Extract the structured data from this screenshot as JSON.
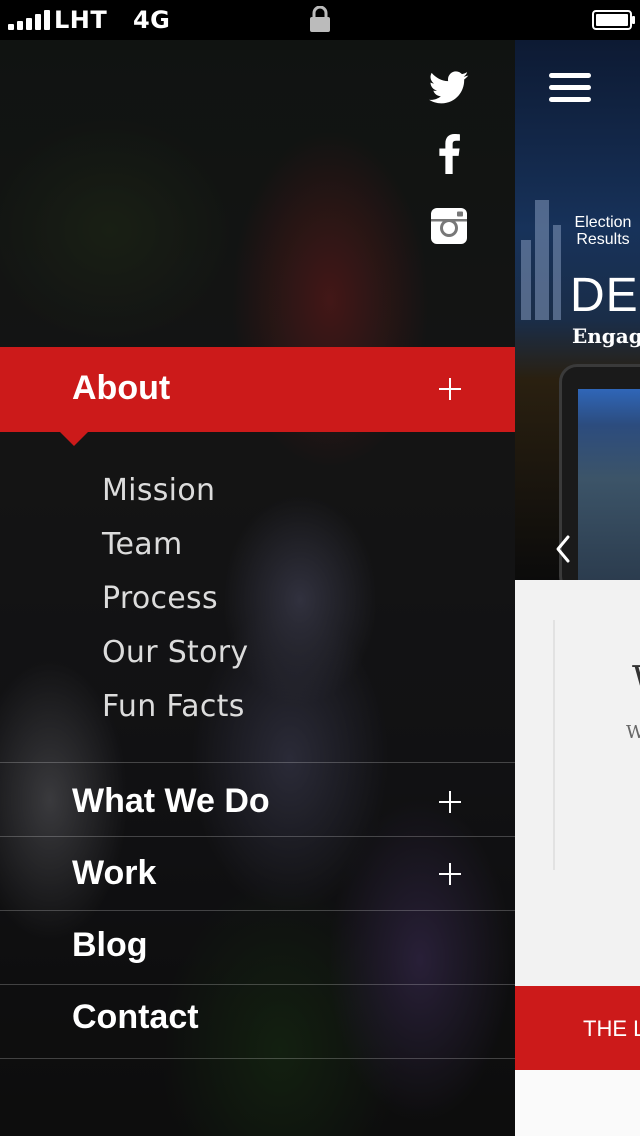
{
  "status_bar": {
    "carrier": "LHT",
    "network": "4G",
    "signal_bars": 5,
    "icons": [
      "signal-icon",
      "lock-icon",
      "battery-icon"
    ]
  },
  "social": {
    "icons": [
      "twitter-icon",
      "facebook-icon",
      "instagram-icon"
    ]
  },
  "menu": {
    "active": {
      "label": "About",
      "expand_icon": "plus-icon"
    },
    "about_submenu": [
      "Mission",
      "Team",
      "Process",
      "Our Story",
      "Fun Facts"
    ],
    "items": [
      {
        "label": "What We Do",
        "expandable": true
      },
      {
        "label": "Work",
        "expandable": true
      },
      {
        "label": "Blog",
        "expandable": false
      },
      {
        "label": "Contact",
        "expandable": false
      }
    ]
  },
  "content_peek": {
    "hero_small_line1": "Election",
    "hero_small_line2": "Results",
    "hero_title": "DES",
    "hero_subtitle": "Engage",
    "section_letter": "W",
    "section_small": "W",
    "cta_text": "THE L"
  },
  "colors": {
    "accent_red": "#cc1a1a",
    "menu_text": "#ffffff",
    "submenu_text": "#dcdcdc"
  }
}
